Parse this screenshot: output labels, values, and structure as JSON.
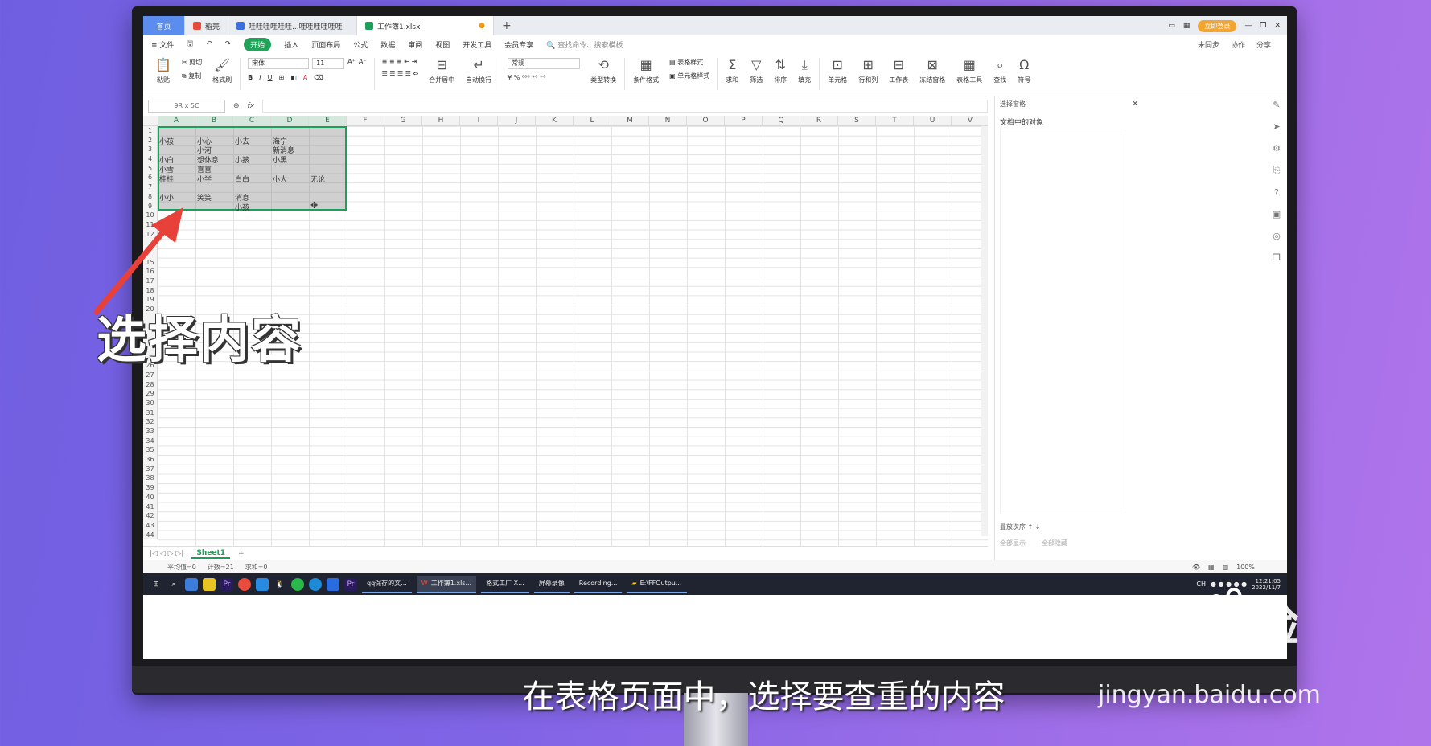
{
  "tabs": [
    {
      "label": "首页",
      "type": "home"
    },
    {
      "label": "稻壳",
      "type": "doc"
    },
    {
      "label": "哇哇哇哇哇哇...哇哇哇哇哇哇",
      "type": "word"
    },
    {
      "label": "工作簿1.xlsx",
      "type": "sheet"
    }
  ],
  "titlebar": {
    "login": "立即登录"
  },
  "menu": {
    "file": "≡ 文件",
    "start": "开始",
    "items": [
      "插入",
      "页面布局",
      "公式",
      "数据",
      "审阅",
      "视图",
      "开发工具",
      "会员专享"
    ],
    "search": "查找命令、搜索模板",
    "sync": "未同步",
    "collab": "协作",
    "share": "分享"
  },
  "ribbon": {
    "paste": "粘贴",
    "cut": "剪切",
    "copy": "复制",
    "format_painter": "格式刷",
    "font": "宋体",
    "size": "11",
    "merge": "合并居中",
    "wrap": "自动换行",
    "numfmt": "常规",
    "convert": "类型转换",
    "cond_format": "条件格式",
    "table_style": "表格样式",
    "cell_style": "单元格样式",
    "sum": "求和",
    "filter": "筛选",
    "sort": "排序",
    "fill": "填充",
    "cell": "单元格",
    "rowcol": "行和列",
    "worksheet": "工作表",
    "freeze": "冻结窗格",
    "table_tools": "表格工具",
    "find": "查找",
    "symbol": "符号"
  },
  "formula": {
    "namebox": "9R x 5C",
    "fx": "fx"
  },
  "columns": [
    "A",
    "B",
    "C",
    "D",
    "E",
    "F",
    "G",
    "H",
    "I",
    "J",
    "K",
    "L",
    "M",
    "N",
    "O",
    "P",
    "Q",
    "R",
    "S",
    "T",
    "U",
    "V"
  ],
  "rows": [
    "1",
    "2",
    "3",
    "4",
    "5",
    "6",
    "7",
    "8",
    "9",
    "10",
    "11",
    "12",
    "",
    "",
    "15",
    "16",
    "17",
    "18",
    "19",
    "20",
    "",
    "",
    "",
    "",
    "",
    "26",
    "27",
    "28",
    "29",
    "30",
    "31",
    "32",
    "33",
    "34",
    "35",
    "36",
    "37",
    "38",
    "39",
    "40",
    "41",
    "42",
    "43",
    "44"
  ],
  "cells": [
    {
      "r": 1,
      "c": 0,
      "v": "小孩"
    },
    {
      "r": 1,
      "c": 1,
      "v": "小心"
    },
    {
      "r": 1,
      "c": 2,
      "v": "小去"
    },
    {
      "r": 1,
      "c": 3,
      "v": "海宁"
    },
    {
      "r": 2,
      "c": 1,
      "v": "小河"
    },
    {
      "r": 2,
      "c": 3,
      "v": "新消息"
    },
    {
      "r": 3,
      "c": 0,
      "v": "小白"
    },
    {
      "r": 3,
      "c": 1,
      "v": "想休息"
    },
    {
      "r": 3,
      "c": 2,
      "v": "小孩"
    },
    {
      "r": 3,
      "c": 3,
      "v": "小黑"
    },
    {
      "r": 4,
      "c": 0,
      "v": "小雪"
    },
    {
      "r": 4,
      "c": 1,
      "v": "喜喜"
    },
    {
      "r": 5,
      "c": 0,
      "v": "桂桂"
    },
    {
      "r": 5,
      "c": 1,
      "v": "小学"
    },
    {
      "r": 5,
      "c": 2,
      "v": "白白"
    },
    {
      "r": 5,
      "c": 3,
      "v": "小大"
    },
    {
      "r": 5,
      "c": 4,
      "v": "无论"
    },
    {
      "r": 7,
      "c": 0,
      "v": "小小"
    },
    {
      "r": 7,
      "c": 1,
      "v": "笑笑"
    },
    {
      "r": 7,
      "c": 2,
      "v": "消息"
    },
    {
      "r": 8,
      "c": 2,
      "v": "小孩"
    }
  ],
  "sheet": {
    "name": "Sheet1"
  },
  "status": {
    "avg": "平均值=0",
    "count": "计数=21",
    "sum": "求和=0",
    "zoom": "100%"
  },
  "pane": {
    "title": "选择窗格",
    "subtitle": "文档中的对象",
    "order": "叠放次序",
    "show_all": "全部显示",
    "hide_all": "全部隐藏"
  },
  "taskbar": {
    "apps": [
      {
        "label": "qq保存的文..."
      },
      {
        "label": "工作簿1.xls..."
      },
      {
        "label": "格式工厂 X..."
      },
      {
        "label": "屏幕录像"
      },
      {
        "label": "Recording..."
      },
      {
        "label": "E:\\FFOutpu..."
      }
    ],
    "ime": "CH",
    "time": "12:21:05",
    "date": "2022/11/7"
  },
  "overlay": {
    "title": "选择内容",
    "subtitle": "在表格页面中，选择要查重的内容"
  },
  "watermark": {
    "logo": "Bai 经验",
    "url": "jingyan.baidu.com"
  },
  "colors": {
    "accent": "#1aa05a",
    "arrow": "#e8413a",
    "home_tab": "#5b8def",
    "login": "#f3a531"
  }
}
